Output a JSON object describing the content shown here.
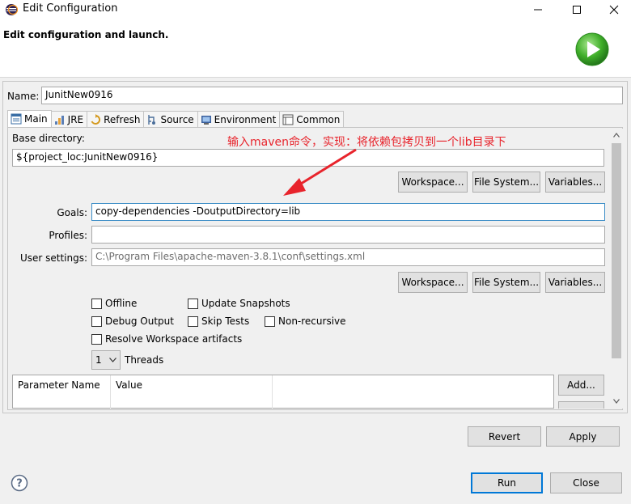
{
  "window": {
    "title": "Edit Configuration",
    "header": "Edit configuration and launch."
  },
  "config": {
    "name_label": "Name:",
    "name_value": "JunitNew0916"
  },
  "tabs": [
    {
      "label": "Main",
      "icon": "main-tab-icon"
    },
    {
      "label": "JRE",
      "icon": "jre-icon"
    },
    {
      "label": "Refresh",
      "icon": "refresh-icon"
    },
    {
      "label": "Source",
      "icon": "source-icon"
    },
    {
      "label": "Environment",
      "icon": "environment-icon"
    },
    {
      "label": "Common",
      "icon": "common-icon"
    }
  ],
  "main": {
    "base_dir_label": "Base directory:",
    "base_dir_value": "${project_loc:JunitNew0916}",
    "workspace_btn": "Workspace...",
    "filesystem_btn": "File System...",
    "variables_btn": "Variables...",
    "goals_label": "Goals:",
    "goals_value": "copy-dependencies -DoutputDirectory=lib",
    "profiles_label": "Profiles:",
    "profiles_value": "",
    "user_settings_label": "User settings:",
    "user_settings_value": "C:\\Program Files\\apache-maven-3.8.1\\conf\\settings.xml",
    "checkboxes": {
      "offline": "Offline",
      "update_snapshots": "Update Snapshots",
      "debug_output": "Debug Output",
      "skip_tests": "Skip Tests",
      "non_recursive": "Non-recursive",
      "resolve_workspace": "Resolve Workspace artifacts"
    },
    "threads_value": "1",
    "threads_label": "Threads",
    "param_table": {
      "col_name": "Parameter Name",
      "col_value": "Value"
    },
    "add_btn": "Add...",
    "annotation": "输入maven命令，实现：将依赖包拷贝到一个lib目录下"
  },
  "buttons": {
    "revert": "Revert",
    "apply": "Apply",
    "run": "Run",
    "close": "Close"
  },
  "colors": {
    "accent": "#0078d7",
    "annotation": "#e8242c",
    "run_icon": "#3fae29"
  }
}
